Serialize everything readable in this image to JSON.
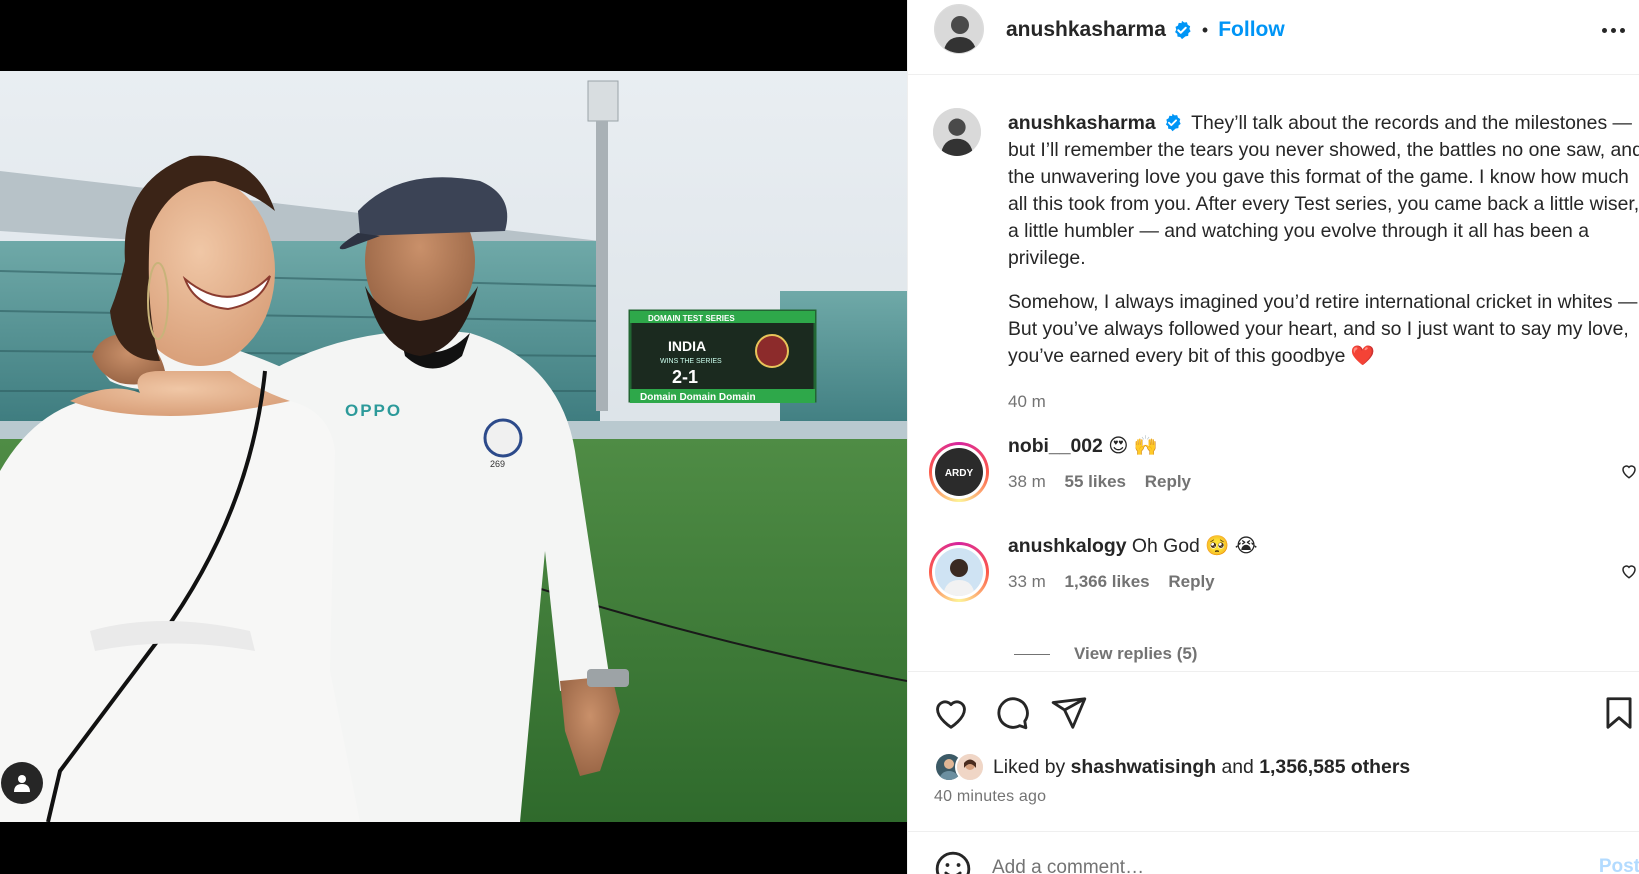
{
  "post": {
    "username": "anushkasharma",
    "separator": "•",
    "follow_label": "Follow",
    "caption_p1": "They’ll talk about the records and the milestones — but I’ll remember the tears you never showed, the battles no one saw, and the unwavering love you gave this format of the game. I know how much all this took from you. After every Test series, you came back a little wiser, a little humbler — and watching you evolve through it all has been a privilege.",
    "caption_p2": "Somehow, I always imagined you’d retire international cricket in whites — But you’ve always followed your heart, and so I just want to say my love, you’ve earned every bit of this goodbye ❤️",
    "caption_time": "40 m"
  },
  "photo": {
    "scoreboard_title": "DOMAIN TEST SERIES",
    "scoreboard_team": "INDIA",
    "scoreboard_sub": "WINS THE SERIES",
    "scoreboard_score": "2-1",
    "ad_board": "Domain",
    "shirt_brand": "OPPO",
    "cap_number": "269"
  },
  "comments": [
    {
      "username": "nobi__002",
      "text": "😍 🙌",
      "time": "38 m",
      "likes": "55 likes",
      "reply_label": "Reply",
      "avatar_text": "ARDY"
    },
    {
      "username": "anushkalogy",
      "text": "Oh God 🥺 😭",
      "time": "33 m",
      "likes": "1,366 likes",
      "reply_label": "Reply"
    }
  ],
  "view_replies": "View replies (5)",
  "likes": {
    "prefix": "Liked by",
    "liker": "shashwatisingh",
    "and": "and",
    "others": "1,356,585 others"
  },
  "time_ago": "40 minutes ago",
  "comment_box": {
    "placeholder": "Add a comment…",
    "post_label": "Post"
  },
  "colors": {
    "follow": "#0095f6",
    "verified": "#0095f6",
    "heart": "#ed4956"
  },
  "icons": [
    "verified-badge-icon",
    "more-options-icon",
    "heart-icon",
    "comment-icon",
    "share-icon",
    "bookmark-icon",
    "emoji-icon",
    "user-tag-icon"
  ]
}
